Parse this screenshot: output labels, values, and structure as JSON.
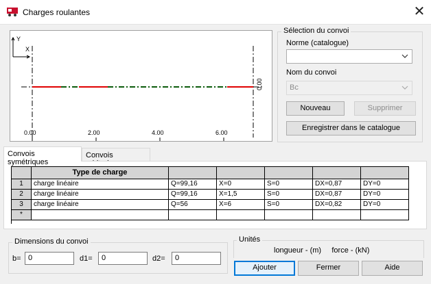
{
  "window": {
    "title": "Charges roulantes",
    "close_symbol": "✕"
  },
  "preview": {
    "y_axis_label": "Y",
    "x_axis_label": "X",
    "right_value": "0.00",
    "ticks": [
      "0.00",
      "2.00",
      "4.00",
      "6.00"
    ]
  },
  "selection": {
    "title": "Sélection du convoi",
    "norme_label": "Norme (catalogue)",
    "norme_value": "",
    "nom_label": "Nom du convoi",
    "nom_value": "Bc",
    "nouveau_label": "Nouveau",
    "supprimer_label": "Supprimer",
    "enregistrer_label": "Enregistrer dans le catalogue"
  },
  "tabs": [
    {
      "label": "Convois symétriques",
      "active": true
    },
    {
      "label": "Convois arbitraires",
      "active": false
    }
  ],
  "table": {
    "header": "Type de charge",
    "rows": [
      {
        "num": "1",
        "type": "charge linéaire",
        "c1": "Q=99,16",
        "c2": "X=0",
        "c3": "S=0",
        "c4": "DX=0,87",
        "c5": "DY=0"
      },
      {
        "num": "2",
        "type": "charge linéaire",
        "c1": "Q=99,16",
        "c2": "X=1,5",
        "c3": "S=0",
        "c4": "DX=0,87",
        "c5": "DY=0"
      },
      {
        "num": "3",
        "type": "charge linéaire",
        "c1": "Q=56",
        "c2": "X=6",
        "c3": "S=0",
        "c4": "DX=0,82",
        "c5": "DY=0"
      }
    ],
    "new_row_marker": "*"
  },
  "dimensions": {
    "title": "Dimensions du convoi",
    "b_label": "b=",
    "b_value": "0",
    "d1_label": "d1=",
    "d1_value": "0",
    "d2_label": "d2=",
    "d2_value": "0"
  },
  "units": {
    "title": "Unités",
    "text": "longueur - (m)     force - (kN)"
  },
  "buttons": {
    "ajouter": "Ajouter",
    "fermer": "Fermer",
    "aide": "Aide"
  }
}
